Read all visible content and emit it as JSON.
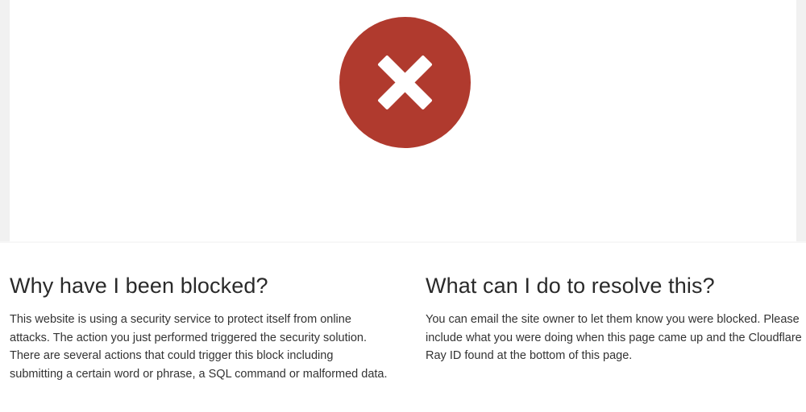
{
  "hero": {
    "icon": "error-x-icon",
    "icon_color": "#b03a2e"
  },
  "left_section": {
    "heading": "Why have I been blocked?",
    "body": "This website is using a security service to protect itself from online attacks. The action you just performed triggered the security solution. There are several actions that could trigger this block including submitting a certain word or phrase, a SQL command or malformed data."
  },
  "right_section": {
    "heading": "What can I do to resolve this?",
    "body": "You can email the site owner to let them know you were blocked. Please include what you were doing when this page came up and the Cloudflare Ray ID found at the bottom of this page."
  }
}
